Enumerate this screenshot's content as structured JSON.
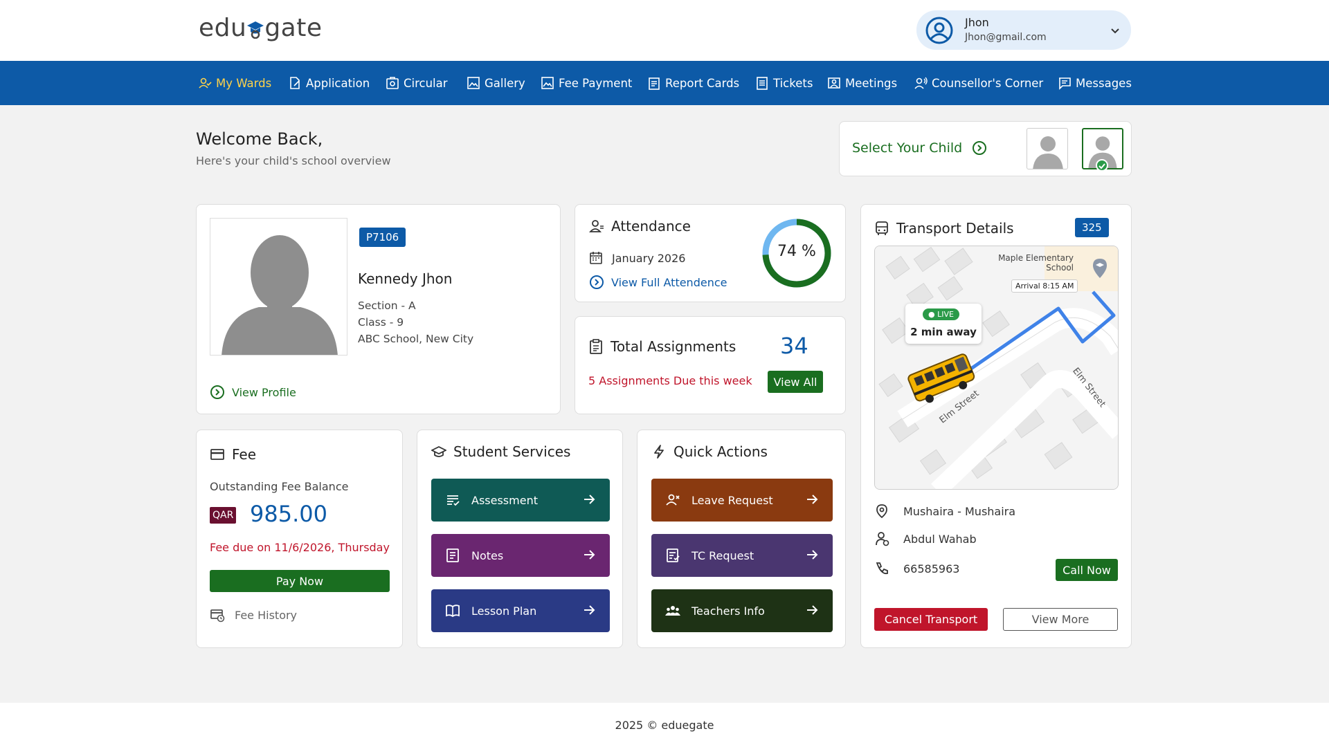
{
  "header": {
    "logo_left": "edu",
    "logo_right": "gate",
    "user": {
      "name": "Jhon",
      "email": "Jhon@gmail.com"
    }
  },
  "nav": {
    "items": [
      {
        "label": "My Wards",
        "icon": "user-group-icon",
        "active": true
      },
      {
        "label": "Application",
        "icon": "edit-document-icon"
      },
      {
        "label": "Circular",
        "icon": "circular-icon"
      },
      {
        "label": "Gallery",
        "icon": "gallery-icon"
      },
      {
        "label": "Fee Payment",
        "icon": "image-icon"
      },
      {
        "label": "Report Cards",
        "icon": "report-icon"
      },
      {
        "label": "Tickets",
        "icon": "ticket-icon"
      },
      {
        "label": "Meetings",
        "icon": "meeting-icon"
      },
      {
        "label": "Counsellor's Corner",
        "icon": "counsellor-icon"
      },
      {
        "label": "Messages",
        "icon": "message-icon"
      }
    ],
    "active_color": "#ffd24a"
  },
  "welcome": {
    "title": "Welcome Back,",
    "subtitle": "Here's your child's school overview"
  },
  "select_child": {
    "label": "Select Your Child"
  },
  "student": {
    "id_badge": "P7106",
    "name": "Kennedy Jhon",
    "section": "Section - A",
    "class": "Class - 9",
    "school": "ABC School, New City",
    "view_profile": "View Profile"
  },
  "attendance": {
    "title": "Attendance",
    "month": "January 2026",
    "link": "View Full Attendence",
    "percent": 74,
    "percent_label": "74 %"
  },
  "assignments": {
    "title": "Total Assignments",
    "count": "34",
    "due_text": "5 Assignments  Due this week",
    "view_all": "View All"
  },
  "transport": {
    "title": "Transport Details",
    "badge": "325",
    "map": {
      "school_name_line1": "Maple Elementary",
      "school_name_line2": "School",
      "arrival": "Arrival 8:15 AM",
      "live": "LIVE",
      "eta": "2 min away",
      "street1": "Elm Street",
      "street2": "Elm Street"
    },
    "stop": "Mushaira - Mushaira",
    "driver": "Abdul Wahab",
    "phone": "66585963",
    "call_now": "Call Now",
    "cancel": "Cancel Transport",
    "view_more": "View More"
  },
  "fee": {
    "title": "Fee",
    "label": "Outstanding Fee Balance",
    "currency": "QAR",
    "amount": "985.00",
    "due": "Fee due on 11/6/2026, Thursday",
    "pay_now": "Pay Now",
    "history": "Fee History"
  },
  "services": {
    "title": "Student Services",
    "items": [
      {
        "label": "Assessment",
        "color": "#0f5a55",
        "icon": "list-check-icon"
      },
      {
        "label": "Notes",
        "color": "#6a2670",
        "icon": "notes-icon"
      },
      {
        "label": "Lesson Plan",
        "color": "#2a3a85",
        "icon": "book-icon"
      }
    ]
  },
  "quick_actions": {
    "title": "Quick Actions",
    "items": [
      {
        "label": "Leave Request",
        "color": "#8a3a10",
        "icon": "user-remove-icon"
      },
      {
        "label": "TC Request",
        "color": "#4a3670",
        "icon": "document-request-icon"
      },
      {
        "label": "Teachers Info",
        "color": "#1e3215",
        "icon": "team-icon"
      }
    ]
  },
  "footer": {
    "text": "2025 © eduegate"
  }
}
